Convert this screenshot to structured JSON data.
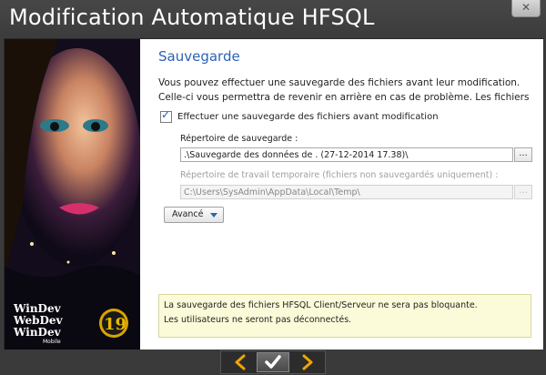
{
  "window": {
    "title": "Modification Automatique HFSQL",
    "close_icon": "close-icon"
  },
  "side_image": {
    "brand_lines": [
      "WinDev",
      "WebDev",
      "WinDev Mobile"
    ],
    "badge": "19"
  },
  "main": {
    "section_title": "Sauvegarde",
    "description_line1": "Vous pouvez effectuer une sauvegarde des fichiers avant leur modification.",
    "description_line2": "Celle-ci vous permettra de revenir en arrière en cas de problème. Les fichiers",
    "backup_checkbox": {
      "label": "Effectuer une sauvegarde des fichiers avant modification",
      "checked": true
    },
    "backup_dir": {
      "label": "Répertoire de sauvegarde :",
      "value": ".\\Sauvegarde des données de . (27-12-2014 17.38)\\",
      "browse_label": "..."
    },
    "temp_dir": {
      "label": "Répertoire de travail temporaire (fichiers non sauvegardés uniquement) :",
      "value": "C:\\Users\\SysAdmin\\AppData\\Local\\Temp\\",
      "browse_label": "...",
      "enabled": false
    },
    "advanced_button": "Avancé",
    "info_line1": "La sauvegarde des fichiers HFSQL Client/Serveur ne sera pas bloquante.",
    "info_line2": "Les utilisateurs ne seront pas déconnectés."
  },
  "navigation": {
    "prev_icon": "chevron-left-icon",
    "ok_icon": "checkmark-icon",
    "next_icon": "chevron-right-icon"
  },
  "colors": {
    "accent": "#2b63b5",
    "nav_arrow": "#f0a500",
    "info_bg": "#fbfbd9"
  }
}
